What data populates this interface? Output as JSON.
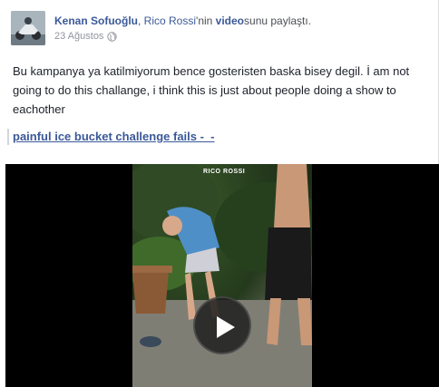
{
  "post": {
    "author": "Kenan Sofuoğlu",
    "separator": ", ",
    "video_owner": "Rico Rossi",
    "owner_suffix": "'nin ",
    "video_word": "video",
    "share_suffix": "sunu paylaştı.",
    "date": "23 Ağustos",
    "privacy_icon": "globe-icon",
    "text": "Bu kampanya ya katilmiyorum bence gosteristen baska bisey degil. İ am not going to do this challange, i think this is just about people doing a show to eachother"
  },
  "attachment": {
    "title": "painful ice bucket challenge fails -_-",
    "video_logo": "RICO ROSSI",
    "play_icon": "play-icon"
  }
}
